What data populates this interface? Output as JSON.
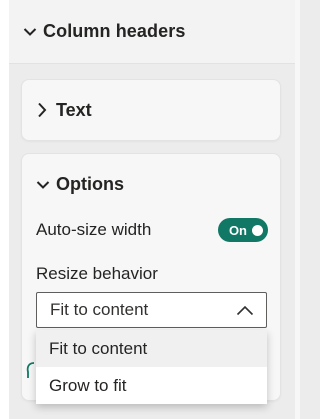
{
  "section": {
    "title": "Column headers",
    "chevron_icon": "chevron-down-icon"
  },
  "cards": {
    "text": {
      "title": "Text",
      "chevron_icon": "chevron-right-icon"
    },
    "options": {
      "title": "Options",
      "chevron_icon": "chevron-down-icon",
      "auto_size": {
        "label": "Auto-size width",
        "toggle_text": "On",
        "state": true
      },
      "resize": {
        "label": "Resize behavior",
        "selected": "Fit to content",
        "expanded_icon": "chevron-up-icon",
        "options": [
          "Fit to content",
          "Grow to fit"
        ]
      }
    }
  },
  "colors": {
    "toggle_on": "#117865",
    "peek_icon": "#117865"
  }
}
